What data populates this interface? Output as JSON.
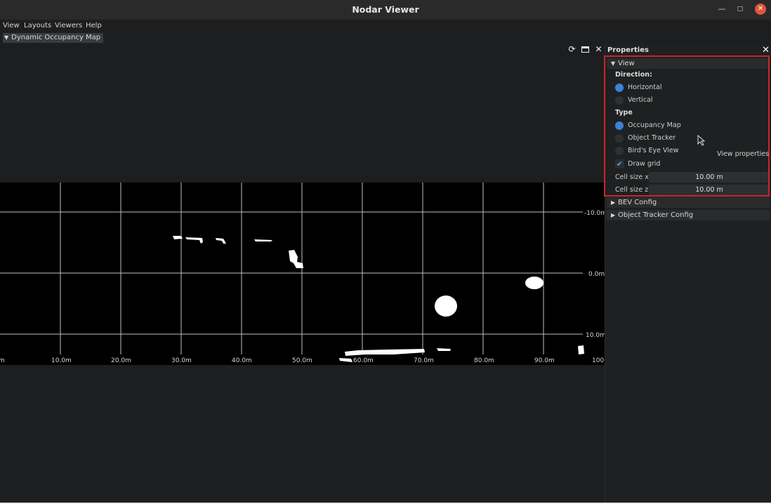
{
  "window": {
    "title": "Nodar Viewer"
  },
  "menu": [
    "View",
    "Layouts",
    "Viewers",
    "Help"
  ],
  "dock_tab": {
    "label": "Dynamic Occupancy Map"
  },
  "viewport_tools": [
    "refresh-icon",
    "maximize-icon",
    "close-icon"
  ],
  "map": {
    "x_ticks": [
      "m",
      "10.0m",
      "20.0m",
      "30.0m",
      "40.0m",
      "50.0m",
      "60.0m",
      "70.0m",
      "80.0m",
      "90.0m",
      "100"
    ],
    "y_ticks": [
      "-10.0m",
      "0.0m",
      "10.0m"
    ]
  },
  "properties": {
    "title": "Properties",
    "view_section": {
      "label": "View",
      "direction_label": "Direction:",
      "direction_options": [
        {
          "label": "Horizontal",
          "selected": true
        },
        {
          "label": "Vertical",
          "selected": false
        }
      ],
      "type_label": "Type",
      "type_options": [
        {
          "label": "Occupancy Map",
          "selected": true
        },
        {
          "label": "Object Tracker",
          "selected": false
        },
        {
          "label": "Bird's Eye View",
          "selected": false
        }
      ],
      "draw_grid": {
        "label": "Draw grid",
        "checked": true
      },
      "cell_size_x": {
        "label": "Cell size x",
        "value": "10.00 m"
      },
      "cell_size_z": {
        "label": "Cell size z",
        "value": "10.00 m"
      }
    },
    "sections": [
      "BEV Config",
      "Object Tracker Config"
    ],
    "tooltip": "View properties"
  },
  "colors": {
    "accent": "#3b82d8",
    "highlight": "#c8262b",
    "close": "#e2543c"
  }
}
